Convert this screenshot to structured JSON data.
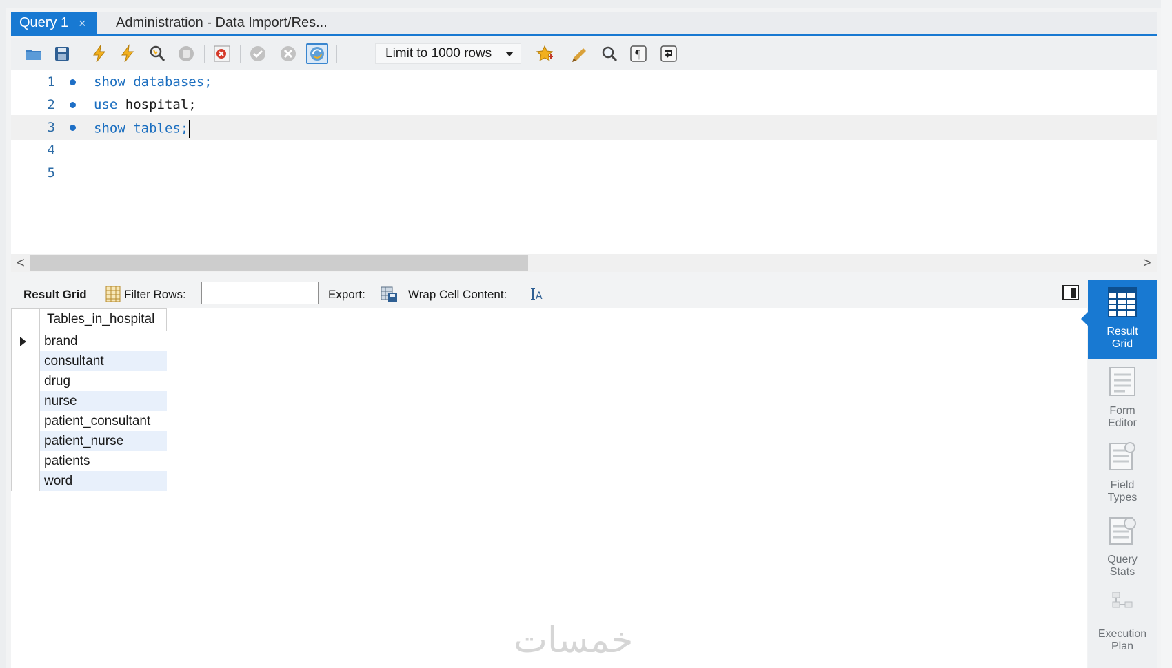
{
  "tabs": [
    {
      "label": "Query 1",
      "active": true
    },
    {
      "label": "Administration - Data Import/Res...",
      "active": false
    }
  ],
  "tab_close_glyph": "×",
  "toolbar": {
    "icons": [
      "open-folder-icon",
      "save-icon",
      "execute-icon",
      "execute-current-icon",
      "explain-icon",
      "stop-icon",
      "toggle-error-icon",
      "commit-icon",
      "rollback-icon",
      "autocommit-icon",
      "bookmark-star-icon",
      "beautify-icon",
      "find-icon",
      "invisible-chars-icon",
      "wrap-icon"
    ],
    "limit_label": "Limit to 1000 rows"
  },
  "editor": {
    "lines": [
      {
        "num": "1",
        "keyword": "show databases;",
        "rest": "",
        "marker": true
      },
      {
        "num": "2",
        "keyword": "use",
        "rest": " hospital;",
        "marker": true
      },
      {
        "num": "3",
        "keyword": "show tables;",
        "rest": "",
        "marker": true,
        "current": true
      },
      {
        "num": "4",
        "keyword": "",
        "rest": "",
        "marker": false
      },
      {
        "num": "5",
        "keyword": "",
        "rest": "",
        "marker": false
      }
    ]
  },
  "scroll": {
    "left_arrow": "<",
    "right_arrow": ">"
  },
  "result_toolbar": {
    "result_grid_label": "Result Grid",
    "filter_label": "Filter Rows:",
    "filter_value": "",
    "export_label": "Export:",
    "wrap_label": "Wrap Cell Content:"
  },
  "grid": {
    "column": "Tables_in_hospital",
    "rows": [
      "brand",
      "consultant",
      "drug",
      "nurse",
      "patient_consultant",
      "patient_nurse",
      "patients",
      "word"
    ]
  },
  "side_panel": [
    {
      "label_1": "Result",
      "label_2": "Grid",
      "active": true,
      "icon": "result-grid-icon"
    },
    {
      "label_1": "Form",
      "label_2": "Editor",
      "active": false,
      "icon": "form-editor-icon"
    },
    {
      "label_1": "Field",
      "label_2": "Types",
      "active": false,
      "icon": "field-types-icon"
    },
    {
      "label_1": "Query",
      "label_2": "Stats",
      "active": false,
      "icon": "query-stats-icon"
    },
    {
      "label_1": "Execution",
      "label_2": "Plan",
      "active": false,
      "icon": "execution-plan-icon"
    }
  ],
  "watermark": "خمسات",
  "colors": {
    "accent": "#1879d2",
    "keyword": "#1c6fc0",
    "line_number": "#2d6ca7"
  }
}
